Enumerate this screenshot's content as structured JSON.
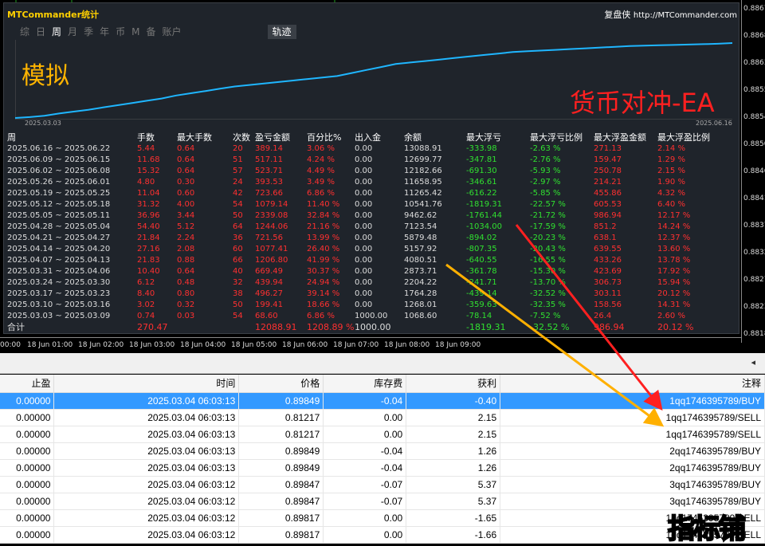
{
  "window": {
    "title": "MTCommander统计",
    "brand": "复盘侠",
    "url": "http://MTCommander.com"
  },
  "tabs": [
    "综",
    "日",
    "周",
    "月",
    "季",
    "年",
    "币",
    "M",
    "备",
    "账户"
  ],
  "active_tab": "周",
  "track_tab": "轨迹",
  "overlay": {
    "sim": "模拟",
    "ea": "货币对冲-EA"
  },
  "curve": {
    "start_date": "2025.03.03",
    "end_date": "2025.06.16",
    "values": [
      0,
      1.2,
      3,
      6,
      8.5,
      11,
      14,
      17,
      20,
      23,
      26,
      30,
      33,
      36,
      39,
      42,
      44,
      46,
      48,
      50,
      52,
      54,
      56,
      60,
      64,
      68,
      72,
      74,
      76,
      78,
      80,
      82,
      84,
      86,
      88,
      89,
      90,
      91,
      92,
      93,
      94,
      95,
      96,
      96.5,
      97,
      97.5,
      98,
      98.5,
      99,
      100
    ]
  },
  "columns": [
    "周",
    "手数",
    "最大手数",
    "次数",
    "盈亏金额",
    "百分比%",
    "出入金",
    "余额",
    "最大浮亏",
    "最大浮亏比例",
    "最大浮盈金额",
    "最大浮盈比例"
  ],
  "rows": [
    [
      "2025.06.16 ~ 2025.06.22",
      "5.44",
      "0.64",
      "20",
      "389.14",
      "3.06 %",
      "0.00",
      "13088.91",
      "-333.98",
      "-2.63 %",
      "271.13",
      "2.14 %"
    ],
    [
      "2025.06.09 ~ 2025.06.15",
      "11.68",
      "0.64",
      "51",
      "517.11",
      "4.24 %",
      "0.00",
      "12699.77",
      "-347.81",
      "-2.76 %",
      "159.47",
      "1.29 %"
    ],
    [
      "2025.06.02 ~ 2025.06.08",
      "15.32",
      "0.64",
      "57",
      "523.71",
      "4.49 %",
      "0.00",
      "12182.66",
      "-691.30",
      "-5.93 %",
      "250.78",
      "2.15 %"
    ],
    [
      "2025.05.26 ~ 2025.06.01",
      "4.80",
      "0.30",
      "24",
      "393.53",
      "3.49 %",
      "0.00",
      "11658.95",
      "-346.61",
      "-2.97 %",
      "214.21",
      "1.90 %"
    ],
    [
      "2025.05.19 ~ 2025.05.25",
      "11.04",
      "0.60",
      "42",
      "723.66",
      "6.86 %",
      "0.00",
      "11265.42",
      "-616.22",
      "-5.85 %",
      "455.86",
      "4.32 %"
    ],
    [
      "2025.05.12 ~ 2025.05.18",
      "31.32",
      "4.00",
      "54",
      "1079.14",
      "11.40 %",
      "0.00",
      "10541.76",
      "-1819.31",
      "-22.57 %",
      "605.53",
      "6.40 %"
    ],
    [
      "2025.05.05 ~ 2025.05.11",
      "36.96",
      "3.44",
      "50",
      "2339.08",
      "32.84 %",
      "0.00",
      "9462.62",
      "-1761.44",
      "-21.72 %",
      "986.94",
      "12.17 %"
    ],
    [
      "2025.04.28 ~ 2025.05.04",
      "54.40",
      "5.12",
      "64",
      "1244.06",
      "21.16 %",
      "0.00",
      "7123.54",
      "-1034.00",
      "-17.59 %",
      "851.2",
      "14.24 %"
    ],
    [
      "2025.04.21 ~ 2025.04.27",
      "21.84",
      "2.24",
      "36",
      "721.56",
      "13.99 %",
      "0.00",
      "5879.48",
      "-894.02",
      "-20.23 %",
      "638.1",
      "12.37 %"
    ],
    [
      "2025.04.14 ~ 2025.04.20",
      "27.16",
      "2.08",
      "60",
      "1077.41",
      "26.40 %",
      "0.00",
      "5157.92",
      "-807.35",
      "-20.43 %",
      "639.55",
      "13.60 %"
    ],
    [
      "2025.04.07 ~ 2025.04.13",
      "21.83",
      "0.88",
      "66",
      "1206.80",
      "41.99 %",
      "0.00",
      "4080.51",
      "-640.55",
      "-16.55 %",
      "433.26",
      "13.78 %"
    ],
    [
      "2025.03.31 ~ 2025.04.06",
      "10.40",
      "0.64",
      "40",
      "669.49",
      "30.37 %",
      "0.00",
      "2873.71",
      "-361.78",
      "-15.30 %",
      "423.69",
      "17.92 %"
    ],
    [
      "2025.03.24 ~ 2025.03.30",
      "6.12",
      "0.48",
      "32",
      "439.94",
      "24.94 %",
      "0.00",
      "2204.22",
      "-241.71",
      "-13.70 %",
      "306.73",
      "15.94 %"
    ],
    [
      "2025.03.17 ~ 2025.03.23",
      "8.40",
      "0.80",
      "38",
      "496.27",
      "39.14 %",
      "0.00",
      "1764.28",
      "-439.14",
      "-32.52 %",
      "303.11",
      "20.12 %"
    ],
    [
      "2025.03.10 ~ 2025.03.16",
      "3.02",
      "0.32",
      "50",
      "199.41",
      "18.66 %",
      "0.00",
      "1268.01",
      "-359.63",
      "-32.35 %",
      "158.56",
      "14.31 %"
    ],
    [
      "2025.03.03 ~ 2025.03.09",
      "0.74",
      "0.03",
      "54",
      "68.60",
      "6.86 %",
      "1000.00",
      "1068.60",
      "-78.14",
      "-7.52 %",
      "26.4",
      "2.60 %"
    ]
  ],
  "total": [
    "合计",
    "270.47",
    "",
    "",
    "12088.91",
    "1208.89 %",
    "1000.00",
    "",
    "-1819.31",
    "-32.52 %",
    "986.94",
    "20.12 %"
  ],
  "price_axis": [
    "0.8867",
    "0.8868",
    "0.8863",
    "0.8855",
    "0.8854",
    "0.8850",
    "0.8846",
    "0.8841",
    "0.8837",
    "0.8832",
    "0.8827",
    "0.8823",
    "0.8818"
  ],
  "time_axis": [
    "00:00",
    "18 Jun 01:00",
    "18 Jun 02:00",
    "18 Jun 03:00",
    "18 Jun 04:00",
    "18 Jun 05:00",
    "18 Jun 06:00",
    "18 Jun 07:00",
    "18 Jun 08:00",
    "18 Jun 09:00"
  ],
  "grid": {
    "headers": [
      "止盈",
      "时间",
      "价格",
      "库存费",
      "获利",
      "注释"
    ],
    "rows": [
      [
        "0.00000",
        "2025.03.04 06:03:13",
        "0.89849",
        "-0.04",
        "-0.40",
        "1qq1746395789/BUY"
      ],
      [
        "0.00000",
        "2025.03.04 06:03:13",
        "0.81217",
        "0.00",
        "2.15",
        "1qq1746395789/SELL"
      ],
      [
        "0.00000",
        "2025.03.04 06:03:13",
        "0.81217",
        "0.00",
        "2.15",
        "1qq1746395789/SELL"
      ],
      [
        "0.00000",
        "2025.03.04 06:03:13",
        "0.89849",
        "-0.04",
        "1.26",
        "2qq1746395789/BUY"
      ],
      [
        "0.00000",
        "2025.03.04 06:03:13",
        "0.89849",
        "-0.04",
        "1.26",
        "2qq1746395789/BUY"
      ],
      [
        "0.00000",
        "2025.03.04 06:03:12",
        "0.89847",
        "-0.07",
        "5.37",
        "3qq1746395789/BUY"
      ],
      [
        "0.00000",
        "2025.03.04 06:03:12",
        "0.89847",
        "-0.07",
        "5.37",
        "3qq1746395789/BUY"
      ],
      [
        "0.00000",
        "2025.03.04 06:03:12",
        "0.89817",
        "0.00",
        "-1.65",
        "1qq1746395789/SELL"
      ],
      [
        "0.00000",
        "2025.03.04 06:03:12",
        "0.89817",
        "0.00",
        "-1.66",
        "1qq1746395789/SELL"
      ]
    ]
  },
  "watermark": "指标铺",
  "colors": {
    "curve": "#1fb6ff",
    "arrow_red": "#ff2020",
    "arrow_orange": "#ffb000",
    "selected": "#3399ff"
  }
}
